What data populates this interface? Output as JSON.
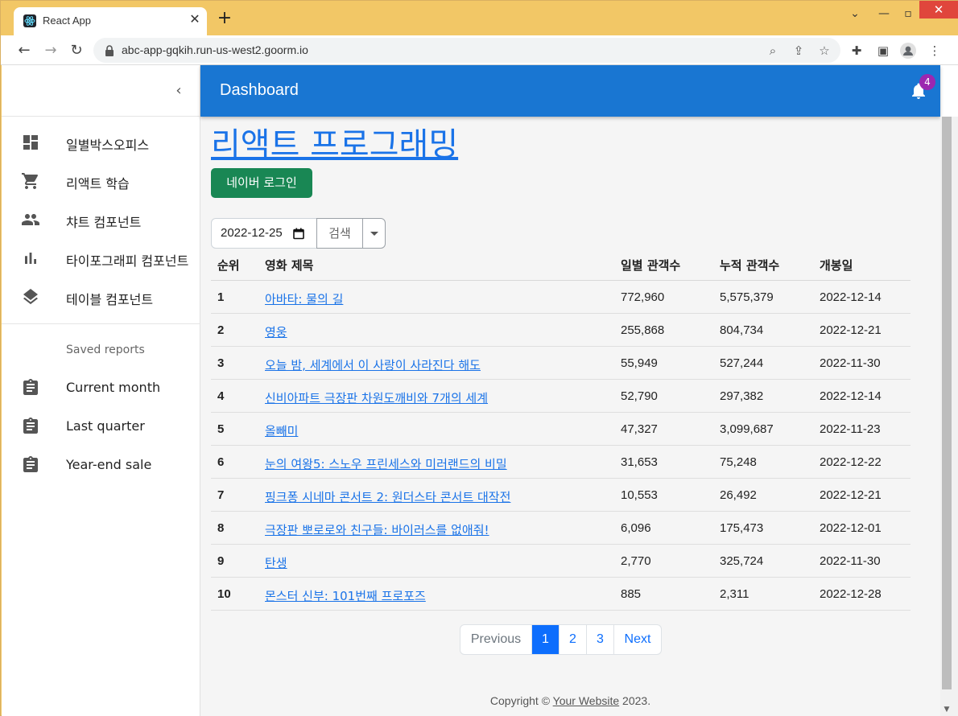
{
  "browser": {
    "tab_title": "React App",
    "url": "abc-app-gqkih.run-us-west2.goorm.io"
  },
  "sidebar": {
    "items": [
      {
        "label": "일별박스오피스",
        "icon": "dashboard-icon"
      },
      {
        "label": "리액트 학습",
        "icon": "shopping-cart-icon"
      },
      {
        "label": "챠트 컴포넌트",
        "icon": "people-icon"
      },
      {
        "label": "타이포그래피 컴포넌트",
        "icon": "bar-chart-icon"
      },
      {
        "label": "테이블 컴포넌트",
        "icon": "layers-icon"
      }
    ],
    "saved_reports_header": "Saved reports",
    "saved_reports": [
      {
        "label": "Current month",
        "icon": "assignment-icon"
      },
      {
        "label": "Last quarter",
        "icon": "assignment-icon"
      },
      {
        "label": "Year-end sale",
        "icon": "assignment-icon"
      }
    ]
  },
  "appbar": {
    "title": "Dashboard",
    "notification_count": "4",
    "color": "#1976d2",
    "badge_color": "#9c27b0"
  },
  "main": {
    "heading": "리액트 프로그래밍",
    "naver_login_label": "네이버 로그인",
    "date_value": "2022-12-25",
    "search_label": "검색"
  },
  "table": {
    "headers": [
      "순위",
      "영화 제목",
      "일별 관객수",
      "누적 관객수",
      "개봉일"
    ],
    "rows": [
      {
        "rank": "1",
        "title": "아바타: 물의 길",
        "daily": "772,960",
        "total": "5,575,379",
        "release": "2022-12-14"
      },
      {
        "rank": "2",
        "title": "영웅",
        "daily": "255,868",
        "total": "804,734",
        "release": "2022-12-21"
      },
      {
        "rank": "3",
        "title": "오늘 밤, 세계에서 이 사랑이 사라진다 해도",
        "daily": "55,949",
        "total": "527,244",
        "release": "2022-11-30"
      },
      {
        "rank": "4",
        "title": "신비아파트 극장판 차원도깨비와 7개의 세계",
        "daily": "52,790",
        "total": "297,382",
        "release": "2022-12-14"
      },
      {
        "rank": "5",
        "title": "올빼미",
        "daily": "47,327",
        "total": "3,099,687",
        "release": "2022-11-23"
      },
      {
        "rank": "6",
        "title": "눈의 여왕5: 스노우 프린세스와 미러랜드의 비밀",
        "daily": "31,653",
        "total": "75,248",
        "release": "2022-12-22"
      },
      {
        "rank": "7",
        "title": "핑크퐁 시네마 콘서트 2: 원더스타 콘서트 대작전",
        "daily": "10,553",
        "total": "26,492",
        "release": "2022-12-21"
      },
      {
        "rank": "8",
        "title": "극장판 뽀로로와 친구들: 바이러스를 없애줘!",
        "daily": "6,096",
        "total": "175,473",
        "release": "2022-12-01"
      },
      {
        "rank": "9",
        "title": "탄생",
        "daily": "2,770",
        "total": "325,724",
        "release": "2022-11-30"
      },
      {
        "rank": "10",
        "title": "몬스터 신부: 101번째 프로포즈",
        "daily": "885",
        "total": "2,311",
        "release": "2022-12-28"
      }
    ]
  },
  "pagination": {
    "previous": "Previous",
    "pages": [
      "1",
      "2",
      "3"
    ],
    "active_page": "1",
    "next": "Next"
  },
  "footer": {
    "prefix": "Copyright © ",
    "link": "Your Website",
    "suffix": " 2023."
  }
}
